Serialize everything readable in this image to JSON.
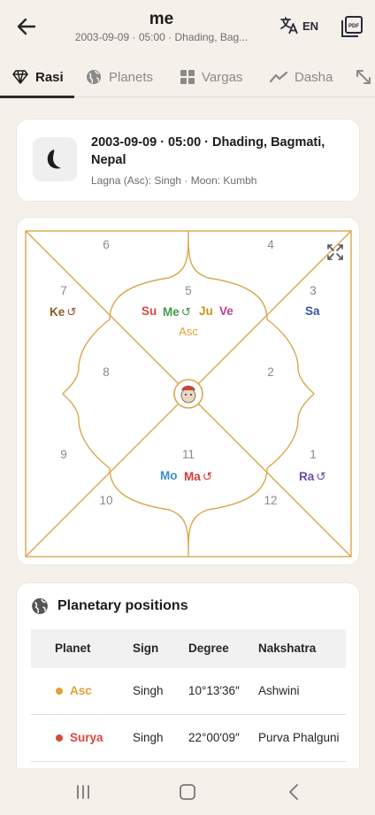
{
  "header": {
    "title": "me",
    "subtitle": "2003-09-09 · 05:00 · Dhading, Bag...",
    "lang_label": "EN"
  },
  "tabs": [
    {
      "label": "Rasi",
      "icon": "diamond-icon",
      "active": true
    },
    {
      "label": "Planets",
      "icon": "globe-icon",
      "active": false
    },
    {
      "label": "Vargas",
      "icon": "grid-icon",
      "active": false
    },
    {
      "label": "Dasha",
      "icon": "trend-icon",
      "active": false
    }
  ],
  "info": {
    "title": "2003-09-09 · 05:00 · Dhading, Bagmati, Nepal",
    "subtitle": "Lagna (Asc): Singh · Moon: Kumbh",
    "icon": "moon-icon"
  },
  "chart": {
    "line_color": "#d8a84e",
    "houses": [
      "6",
      "4",
      "7",
      "5",
      "3",
      "8",
      "2",
      "9",
      "11",
      "1",
      "10",
      "12"
    ],
    "planets": {
      "house7": "Ke",
      "house5": [
        "Su",
        "Me",
        "Ju",
        "Ve"
      ],
      "house5_asc": "Asc",
      "house3": "Sa",
      "house11": [
        "Mo",
        "Ma"
      ],
      "house1": "Ra"
    },
    "retro_symbol": "↺"
  },
  "table": {
    "title": "Planetary positions",
    "columns": [
      "Planet",
      "Sign",
      "Degree",
      "Nakshatra"
    ],
    "rows": [
      {
        "planet": "Asc",
        "color": "#e3a035",
        "sign": "Singh",
        "degree": "10°13′36″",
        "nakshatra": "Ashwini"
      },
      {
        "planet": "Surya",
        "color": "#d9473c",
        "sign": "Singh",
        "degree": "22°00′09″",
        "nakshatra": "Purva Phalguni"
      }
    ]
  },
  "colors": {
    "accent": "#d8a84e",
    "sun": "#d9473c",
    "mercury": "#3f9a4b",
    "jupiter": "#c8961e",
    "venus": "#c2418f",
    "saturn": "#3a55a8",
    "ketu": "#8d5a2b",
    "moon": "#3a8ed0",
    "mars": "#d23c3c",
    "rahu": "#6b4aa8",
    "asc": "#e3a035"
  }
}
